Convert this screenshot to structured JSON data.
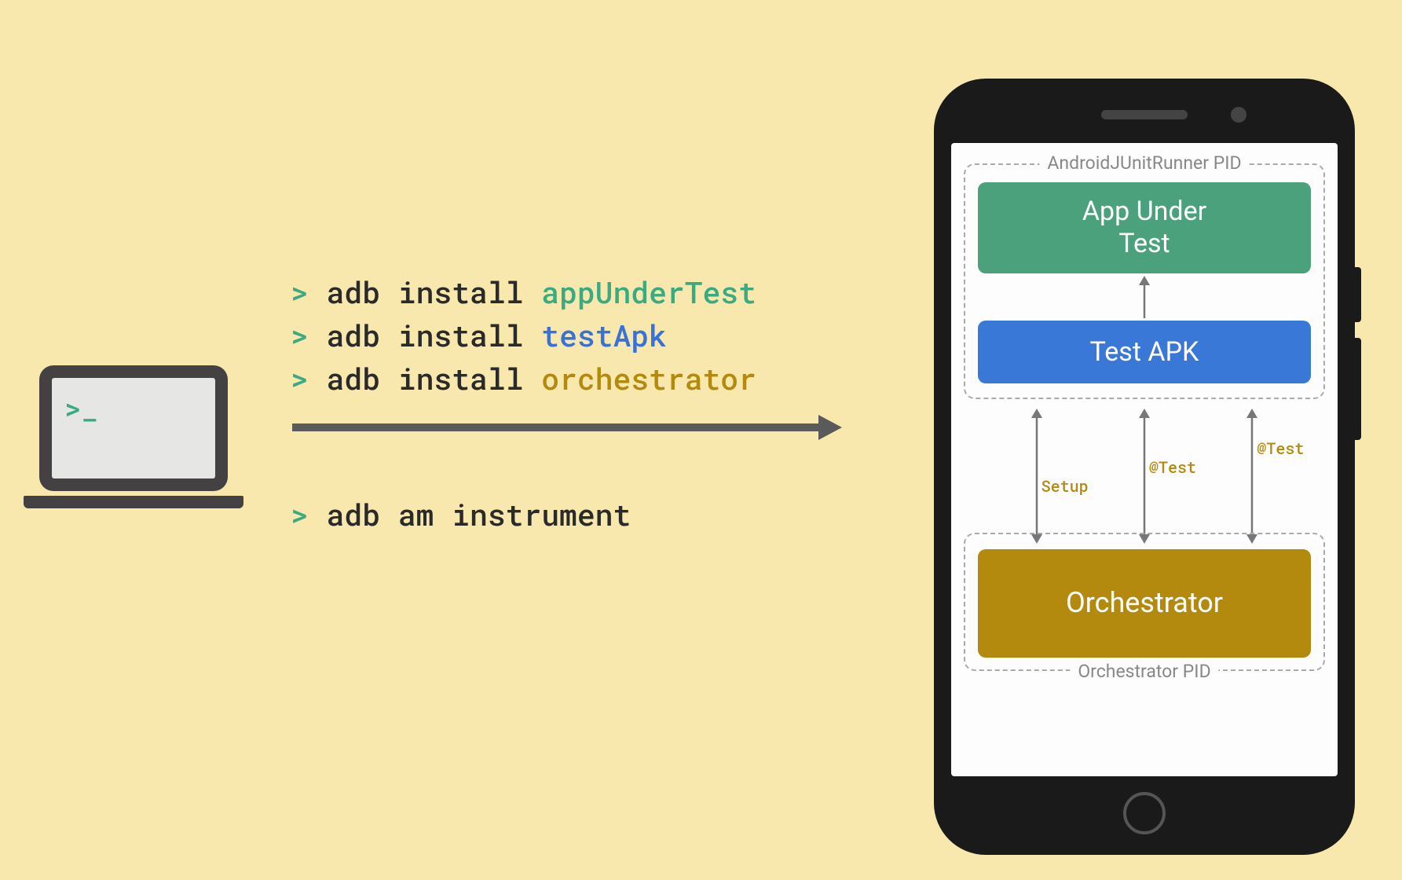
{
  "laptop": {
    "prompt": ">_"
  },
  "commands": {
    "line1": {
      "prompt": "> ",
      "cmd": "adb install ",
      "arg": "appUnderTest"
    },
    "line2": {
      "prompt": "> ",
      "cmd": "adb install ",
      "arg": "testApk"
    },
    "line3": {
      "prompt": "> ",
      "cmd": "adb install ",
      "arg": "orchestrator"
    },
    "line4": {
      "prompt": "> ",
      "cmd": "adb am instrument"
    }
  },
  "phone": {
    "group_top_label": "AndroidJUnitRunner PID",
    "group_bottom_label": "Orchestrator PID",
    "box_app": "App Under\nTest",
    "box_testapk": "Test APK",
    "box_orchestrator": "Orchestrator",
    "mid_labels": [
      "Setup",
      "@Test",
      "@Test"
    ]
  },
  "colors": {
    "green": "#3aaa80",
    "blue": "#3a78d8",
    "gold": "#b38a0d",
    "bg": "#f8e8ae",
    "dark": "#434142"
  }
}
